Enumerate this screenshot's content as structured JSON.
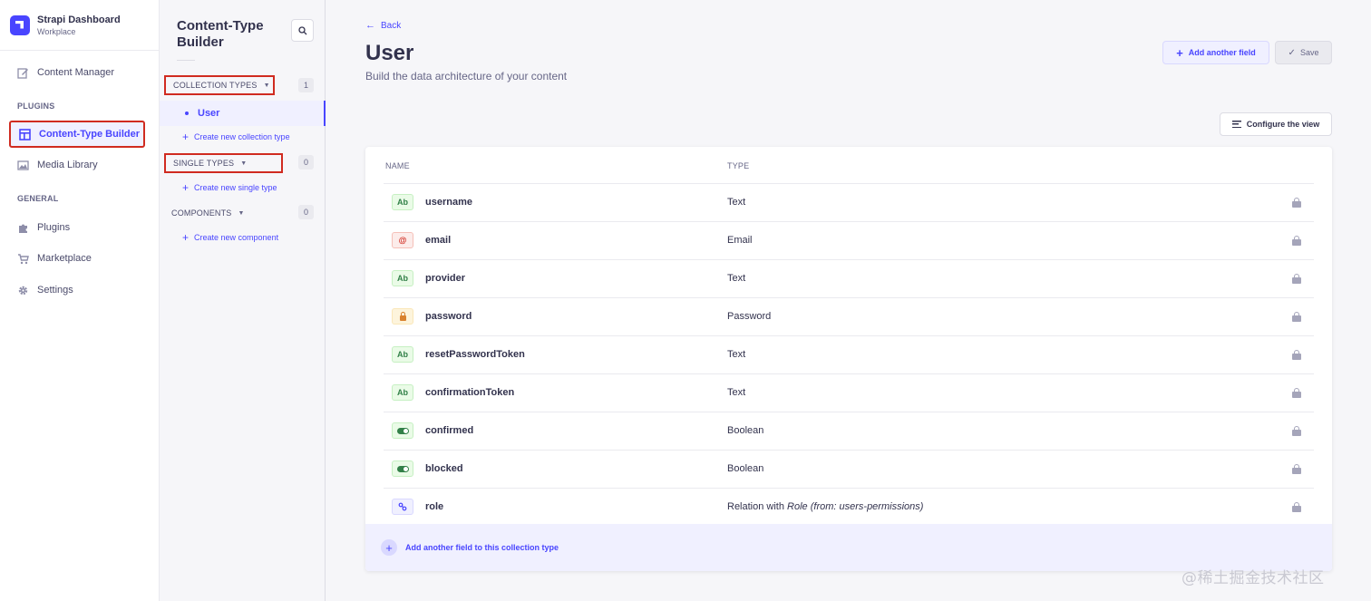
{
  "brand": {
    "title": "Strapi Dashboard",
    "subtitle": "Workplace"
  },
  "mainnav": {
    "content_manager": "Content Manager",
    "plugins_section": "PLUGINS",
    "content_type_builder": "Content-Type Builder",
    "media_library": "Media Library",
    "general_section": "GENERAL",
    "plugins": "Plugins",
    "marketplace": "Marketplace",
    "settings": "Settings"
  },
  "subnav": {
    "title": "Content-Type Builder",
    "collection_types": {
      "label": "COLLECTION TYPES",
      "count": "1",
      "items": [
        "User"
      ],
      "create": "Create new collection type"
    },
    "single_types": {
      "label": "SINGLE TYPES",
      "count": "0",
      "create": "Create new single type"
    },
    "components": {
      "label": "COMPONENTS",
      "count": "0",
      "create": "Create new component"
    }
  },
  "header": {
    "back": "Back",
    "title": "User",
    "subtitle": "Build the data architecture of your content",
    "add_field": "Add another field",
    "save": "Save",
    "configure": "Configure the view"
  },
  "table": {
    "col_name": "NAME",
    "col_type": "TYPE",
    "rows": [
      {
        "badge": "text",
        "name": "username",
        "type": "Text"
      },
      {
        "badge": "email",
        "name": "email",
        "type": "Email"
      },
      {
        "badge": "text",
        "name": "provider",
        "type": "Text"
      },
      {
        "badge": "password",
        "name": "password",
        "type": "Password"
      },
      {
        "badge": "text",
        "name": "resetPasswordToken",
        "type": "Text"
      },
      {
        "badge": "text",
        "name": "confirmationToken",
        "type": "Text"
      },
      {
        "badge": "boolean",
        "name": "confirmed",
        "type": "Boolean"
      },
      {
        "badge": "boolean",
        "name": "blocked",
        "type": "Boolean"
      },
      {
        "badge": "relation",
        "name": "role",
        "type": "Relation with ",
        "type_italic": "Role (from: users-permissions)"
      }
    ],
    "badge_text": "Ab",
    "badge_email": "@",
    "add_footer": "Add another field to this collection type"
  },
  "watermark": "@稀土掘金技术社区",
  "colors": {
    "primary": "#4945ff",
    "highlight_border": "#d02b20"
  }
}
